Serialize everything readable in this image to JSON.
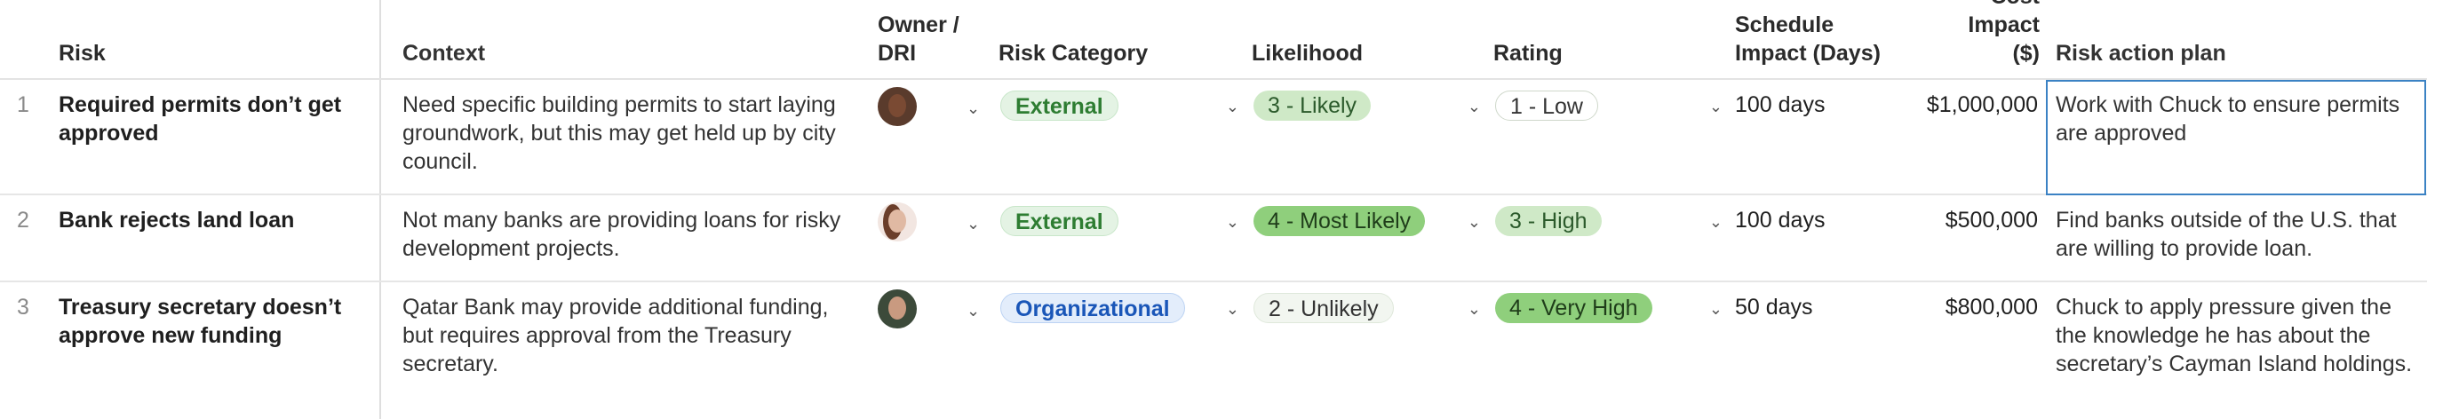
{
  "columns": {
    "risk": "Risk",
    "context": "Context",
    "owner": "Owner / DRI",
    "category": "Risk Category",
    "likelihood": "Likelihood",
    "rating": "Rating",
    "schedule": "Schedule Impact (Days)",
    "cost": "Cost Impact ($)",
    "plan": "Risk action plan"
  },
  "rows": [
    {
      "num": "1",
      "risk": "Required permits don’t get approved",
      "context": "Need specific building permits to start laying groundwork, but this may get held up by city council.",
      "owner_avatar": "avatar-person-1",
      "category": "External",
      "likelihood": "3 - Likely",
      "rating": "1 - Low",
      "schedule": "100 days",
      "cost": "$1,000,000",
      "plan": "Work with Chuck to ensure permits are approved"
    },
    {
      "num": "2",
      "risk": "Bank rejects land loan",
      "context": "Not many banks are providing loans for risky development projects.",
      "owner_avatar": "avatar-person-2",
      "category": "External",
      "likelihood": "4 - Most Likely",
      "rating": "3 - High",
      "schedule": "100 days",
      "cost": "$500,000",
      "plan": "Find banks outside of the U.S. that are willing to provide loan."
    },
    {
      "num": "3",
      "risk": "Treasury secretary doesn’t approve new funding",
      "context": "Qatar Bank may provide additional funding, but requires approval from the Treasury secretary.",
      "owner_avatar": "avatar-person-3",
      "category": "Organizational",
      "likelihood": "2 - Unlikely",
      "rating": "4 - Very High",
      "schedule": "50 days",
      "cost": "$800,000",
      "plan": "Chuck to apply pressure given the the knowledge he has about the secretary’s Cayman Island holdings."
    }
  ],
  "icons": {
    "dropdown": "chevron-down-icon"
  },
  "colors": {
    "external_pill": "#e4f3e4",
    "organizational_pill": "#e3edfb",
    "likely_pill": "#cfe9c7",
    "most_likely_pill": "#8fcf7c",
    "selection_border": "#3b82c4"
  }
}
